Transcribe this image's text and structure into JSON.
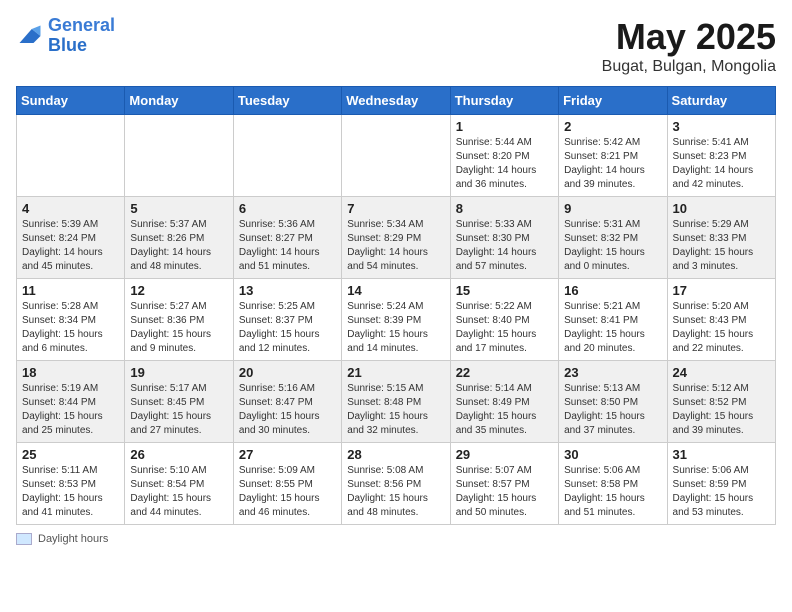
{
  "logo": {
    "line1": "General",
    "line2": "Blue"
  },
  "title": "May 2025",
  "subtitle": "Bugat, Bulgan, Mongolia",
  "days_of_week": [
    "Sunday",
    "Monday",
    "Tuesday",
    "Wednesday",
    "Thursday",
    "Friday",
    "Saturday"
  ],
  "footer_label": "Daylight hours",
  "weeks": [
    [
      {
        "day": "",
        "info": ""
      },
      {
        "day": "",
        "info": ""
      },
      {
        "day": "",
        "info": ""
      },
      {
        "day": "",
        "info": ""
      },
      {
        "day": "1",
        "info": "Sunrise: 5:44 AM\nSunset: 8:20 PM\nDaylight: 14 hours\nand 36 minutes."
      },
      {
        "day": "2",
        "info": "Sunrise: 5:42 AM\nSunset: 8:21 PM\nDaylight: 14 hours\nand 39 minutes."
      },
      {
        "day": "3",
        "info": "Sunrise: 5:41 AM\nSunset: 8:23 PM\nDaylight: 14 hours\nand 42 minutes."
      }
    ],
    [
      {
        "day": "4",
        "info": "Sunrise: 5:39 AM\nSunset: 8:24 PM\nDaylight: 14 hours\nand 45 minutes."
      },
      {
        "day": "5",
        "info": "Sunrise: 5:37 AM\nSunset: 8:26 PM\nDaylight: 14 hours\nand 48 minutes."
      },
      {
        "day": "6",
        "info": "Sunrise: 5:36 AM\nSunset: 8:27 PM\nDaylight: 14 hours\nand 51 minutes."
      },
      {
        "day": "7",
        "info": "Sunrise: 5:34 AM\nSunset: 8:29 PM\nDaylight: 14 hours\nand 54 minutes."
      },
      {
        "day": "8",
        "info": "Sunrise: 5:33 AM\nSunset: 8:30 PM\nDaylight: 14 hours\nand 57 minutes."
      },
      {
        "day": "9",
        "info": "Sunrise: 5:31 AM\nSunset: 8:32 PM\nDaylight: 15 hours\nand 0 minutes."
      },
      {
        "day": "10",
        "info": "Sunrise: 5:29 AM\nSunset: 8:33 PM\nDaylight: 15 hours\nand 3 minutes."
      }
    ],
    [
      {
        "day": "11",
        "info": "Sunrise: 5:28 AM\nSunset: 8:34 PM\nDaylight: 15 hours\nand 6 minutes."
      },
      {
        "day": "12",
        "info": "Sunrise: 5:27 AM\nSunset: 8:36 PM\nDaylight: 15 hours\nand 9 minutes."
      },
      {
        "day": "13",
        "info": "Sunrise: 5:25 AM\nSunset: 8:37 PM\nDaylight: 15 hours\nand 12 minutes."
      },
      {
        "day": "14",
        "info": "Sunrise: 5:24 AM\nSunset: 8:39 PM\nDaylight: 15 hours\nand 14 minutes."
      },
      {
        "day": "15",
        "info": "Sunrise: 5:22 AM\nSunset: 8:40 PM\nDaylight: 15 hours\nand 17 minutes."
      },
      {
        "day": "16",
        "info": "Sunrise: 5:21 AM\nSunset: 8:41 PM\nDaylight: 15 hours\nand 20 minutes."
      },
      {
        "day": "17",
        "info": "Sunrise: 5:20 AM\nSunset: 8:43 PM\nDaylight: 15 hours\nand 22 minutes."
      }
    ],
    [
      {
        "day": "18",
        "info": "Sunrise: 5:19 AM\nSunset: 8:44 PM\nDaylight: 15 hours\nand 25 minutes."
      },
      {
        "day": "19",
        "info": "Sunrise: 5:17 AM\nSunset: 8:45 PM\nDaylight: 15 hours\nand 27 minutes."
      },
      {
        "day": "20",
        "info": "Sunrise: 5:16 AM\nSunset: 8:47 PM\nDaylight: 15 hours\nand 30 minutes."
      },
      {
        "day": "21",
        "info": "Sunrise: 5:15 AM\nSunset: 8:48 PM\nDaylight: 15 hours\nand 32 minutes."
      },
      {
        "day": "22",
        "info": "Sunrise: 5:14 AM\nSunset: 8:49 PM\nDaylight: 15 hours\nand 35 minutes."
      },
      {
        "day": "23",
        "info": "Sunrise: 5:13 AM\nSunset: 8:50 PM\nDaylight: 15 hours\nand 37 minutes."
      },
      {
        "day": "24",
        "info": "Sunrise: 5:12 AM\nSunset: 8:52 PM\nDaylight: 15 hours\nand 39 minutes."
      }
    ],
    [
      {
        "day": "25",
        "info": "Sunrise: 5:11 AM\nSunset: 8:53 PM\nDaylight: 15 hours\nand 41 minutes."
      },
      {
        "day": "26",
        "info": "Sunrise: 5:10 AM\nSunset: 8:54 PM\nDaylight: 15 hours\nand 44 minutes."
      },
      {
        "day": "27",
        "info": "Sunrise: 5:09 AM\nSunset: 8:55 PM\nDaylight: 15 hours\nand 46 minutes."
      },
      {
        "day": "28",
        "info": "Sunrise: 5:08 AM\nSunset: 8:56 PM\nDaylight: 15 hours\nand 48 minutes."
      },
      {
        "day": "29",
        "info": "Sunrise: 5:07 AM\nSunset: 8:57 PM\nDaylight: 15 hours\nand 50 minutes."
      },
      {
        "day": "30",
        "info": "Sunrise: 5:06 AM\nSunset: 8:58 PM\nDaylight: 15 hours\nand 51 minutes."
      },
      {
        "day": "31",
        "info": "Sunrise: 5:06 AM\nSunset: 8:59 PM\nDaylight: 15 hours\nand 53 minutes."
      }
    ]
  ]
}
